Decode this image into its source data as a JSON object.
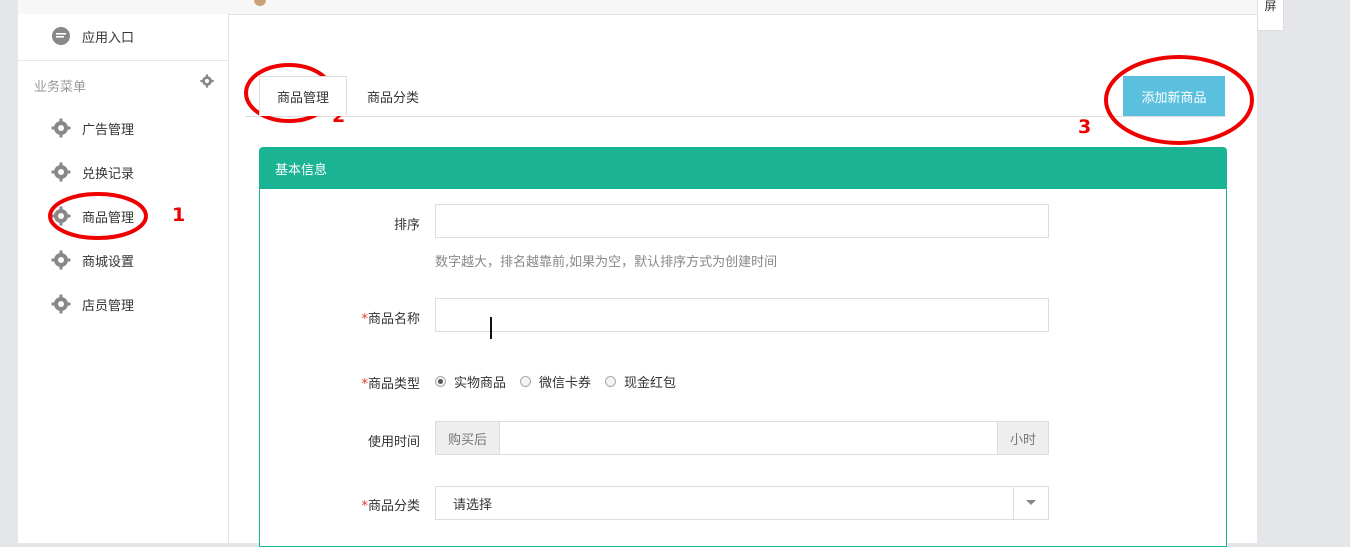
{
  "sidebar": {
    "top_item": "应用入口",
    "menu_title": "业务菜单",
    "items": [
      {
        "label": "广告管理"
      },
      {
        "label": "兑换记录"
      },
      {
        "label": "商品管理"
      },
      {
        "label": "商城设置"
      },
      {
        "label": "店员管理"
      }
    ]
  },
  "right_tab": "屏",
  "tabs": [
    {
      "label": "商品管理",
      "active": true
    },
    {
      "label": "商品分类",
      "active": false
    }
  ],
  "add_button": "添加新商品",
  "panel": {
    "title": "基本信息",
    "fields": {
      "sort": {
        "label": "排序",
        "value": "",
        "help": "数字越大，排名越靠前,如果为空，默认排序方式为创建时间"
      },
      "name": {
        "required": "*",
        "label": "商品名称",
        "value": ""
      },
      "type": {
        "required": "*",
        "label": "商品类型",
        "options": [
          "实物商品",
          "微信卡券",
          "现金红包"
        ],
        "selected": "实物商品"
      },
      "time": {
        "label": "使用时间",
        "prefix": "购买后",
        "value": "",
        "suffix": "小时"
      },
      "category": {
        "required": "*",
        "label": "商品分类",
        "selected": "请选择"
      }
    }
  },
  "annotations": [
    "1",
    "2",
    "3"
  ],
  "colors": {
    "header": "#1ab394",
    "add_button": "#5bc0de",
    "annotation": "#e00000"
  }
}
